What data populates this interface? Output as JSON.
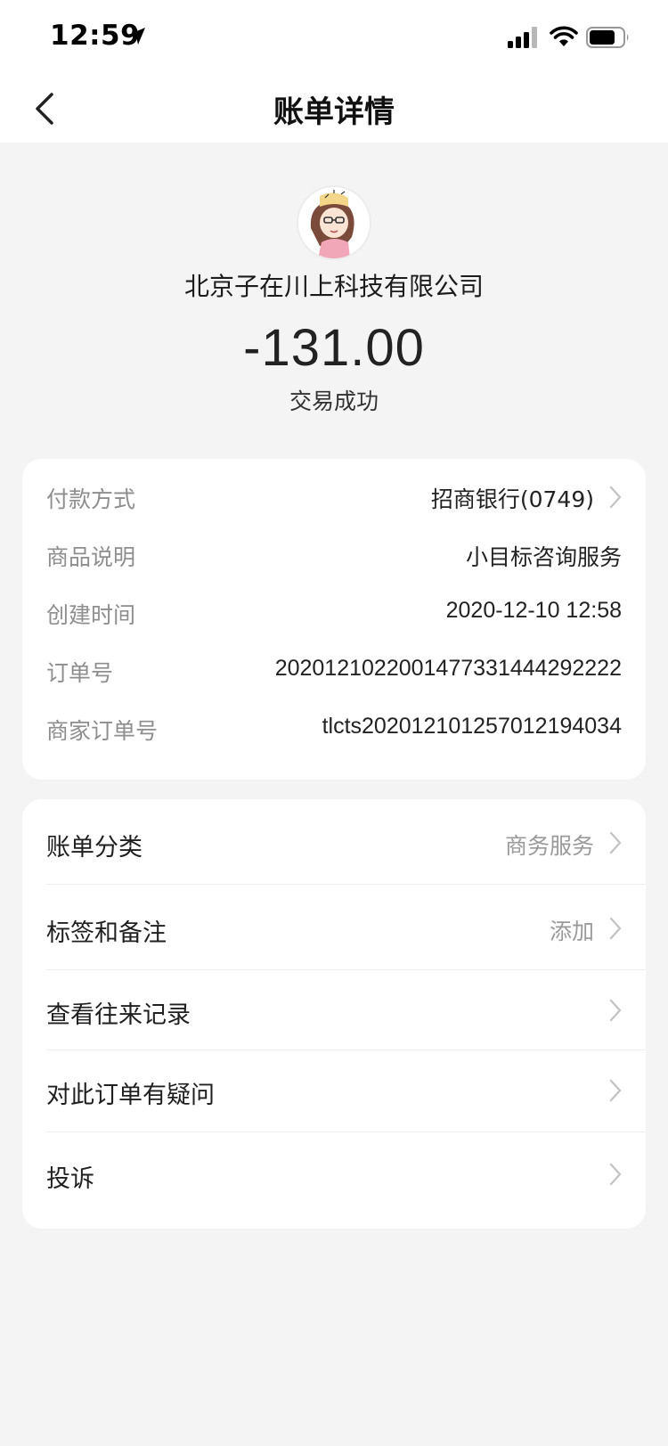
{
  "status_bar": {
    "time": "12:59",
    "icons": [
      "location-arrow-icon",
      "signal-icon",
      "wifi-icon",
      "battery-icon"
    ]
  },
  "nav": {
    "title": "账单详情",
    "back_icon": "chevron-left-icon"
  },
  "summary": {
    "merchant": "北京子在川上科技有限公司",
    "amount": "-131.00",
    "status": "交易成功"
  },
  "details": [
    {
      "label": "付款方式",
      "value": "招商银行(0749)",
      "has_arrow": true
    },
    {
      "label": "商品说明",
      "value": "小目标咨询服务",
      "has_arrow": false
    },
    {
      "label": "创建时间",
      "value": "2020-12-10 12:58",
      "has_arrow": false
    },
    {
      "label": "订单号",
      "value": "2020121022001477331444292222",
      "has_arrow": false
    },
    {
      "label": "商家订单号",
      "value": "tlcts20201210125701219403​4",
      "has_arrow": false
    }
  ],
  "menu": [
    {
      "label": "账单分类",
      "value": "商务服务"
    },
    {
      "label": "标签和备注",
      "value": "添加"
    },
    {
      "label": "查看往来记录",
      "value": ""
    },
    {
      "label": "对此订单有疑问",
      "value": ""
    },
    {
      "label": "投诉",
      "value": ""
    }
  ],
  "colors": {
    "page_bg": "#f4f4f4",
    "card_bg": "#ffffff",
    "label_gray": "#8e8e8e",
    "chevron_gray": "#c4c4c4"
  }
}
